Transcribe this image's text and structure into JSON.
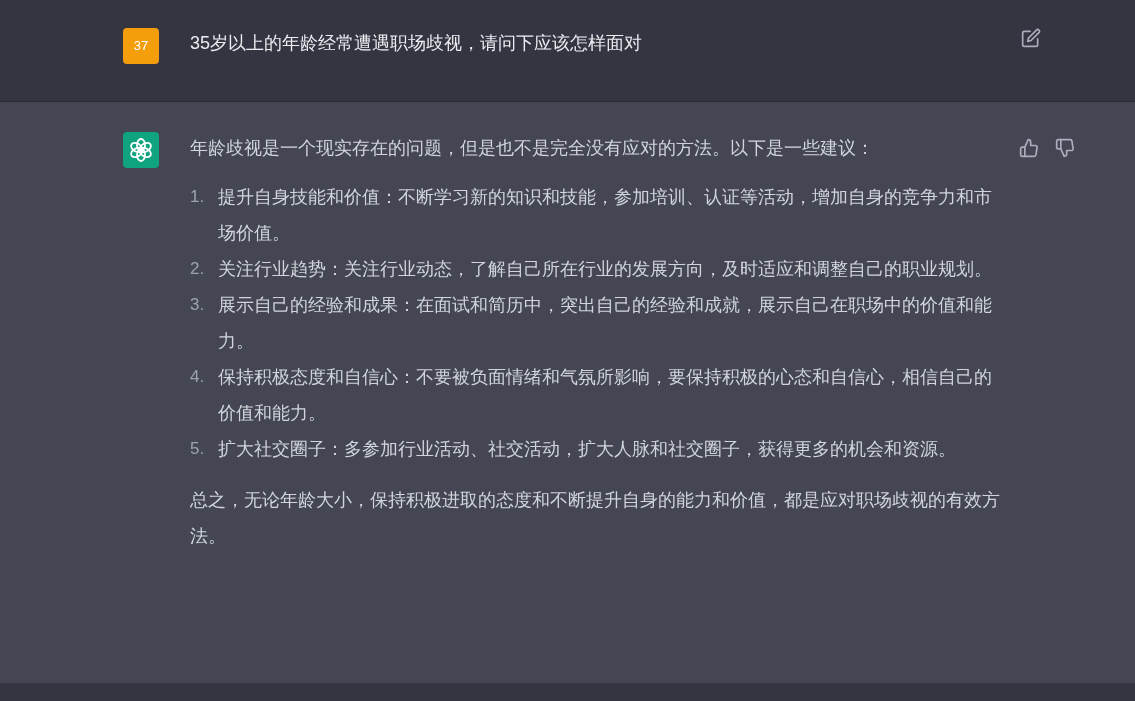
{
  "user_message": {
    "avatar": "37",
    "text": "35岁以上的年龄经常遭遇职场歧视，请问下应该怎样面对"
  },
  "assistant_message": {
    "intro": "年龄歧视是一个现实存在的问题，但是也不是完全没有应对的方法。以下是一些建议：",
    "items": [
      {
        "number": "1.",
        "text": "提升自身技能和价值：不断学习新的知识和技能，参加培训、认证等活动，增加自身的竞争力和市场价值。"
      },
      {
        "number": "2.",
        "text": "关注行业趋势：关注行业动态，了解自己所在行业的发展方向，及时适应和调整自己的职业规划。"
      },
      {
        "number": "3.",
        "text": "展示自己的经验和成果：在面试和简历中，突出自己的经验和成就，展示自己在职场中的价值和能力。"
      },
      {
        "number": "4.",
        "text": "保持积极态度和自信心：不要被负面情绪和气氛所影响，要保持积极的心态和自信心，相信自己的价值和能力。"
      },
      {
        "number": "5.",
        "text": "扩大社交圈子：多参加行业活动、社交活动，扩大人脉和社交圈子，获得更多的机会和资源。"
      }
    ],
    "conclusion": "总之，无论年龄大小，保持积极进取的态度和不断提升自身的能力和价值，都是应对职场歧视的有效方法。"
  }
}
